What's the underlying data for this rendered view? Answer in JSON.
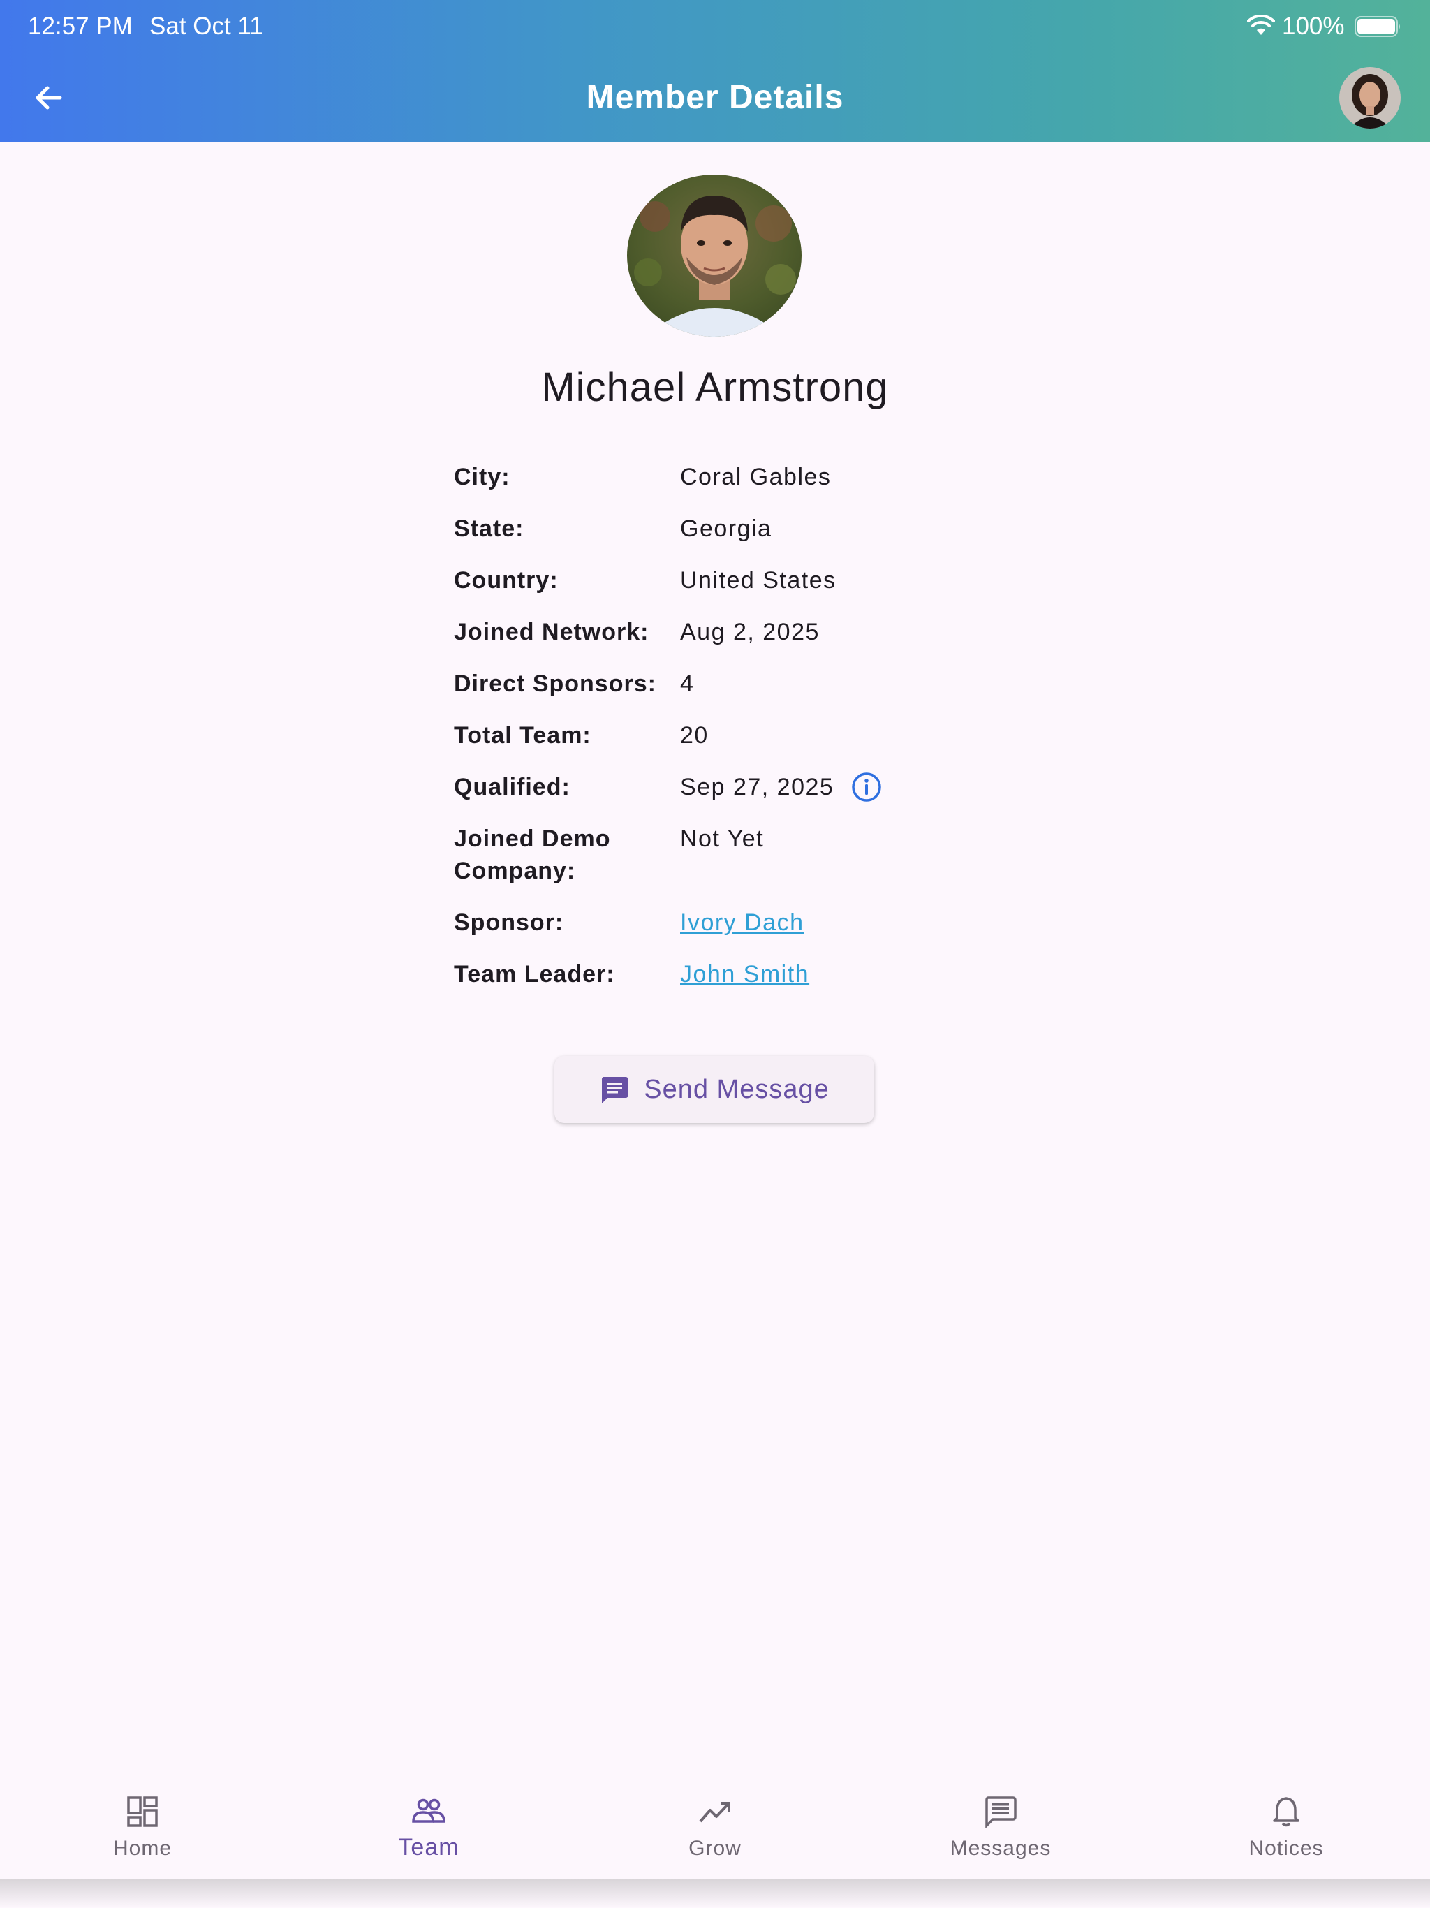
{
  "status_bar": {
    "time": "12:57 PM",
    "date": "Sat Oct 11",
    "battery": "100%"
  },
  "header": {
    "title": "Member Details"
  },
  "member": {
    "name": "Michael Armstrong",
    "details": [
      {
        "label": "City:",
        "value": "Coral Gables"
      },
      {
        "label": "State:",
        "value": "Georgia"
      },
      {
        "label": "Country:",
        "value": "United States"
      },
      {
        "label": "Joined Network:",
        "value": "Aug 2, 2025"
      },
      {
        "label": "Direct Sponsors:",
        "value": "4"
      },
      {
        "label": "Total Team:",
        "value": "20"
      },
      {
        "label": "Qualified:",
        "value": "Sep 27, 2025"
      },
      {
        "label": "Joined Demo Company:",
        "value": "Not Yet"
      },
      {
        "label": "Sponsor:",
        "value": "Ivory Dach"
      },
      {
        "label": "Team Leader:",
        "value": "John Smith"
      }
    ]
  },
  "actions": {
    "send_message": "Send Message"
  },
  "nav": {
    "items": [
      {
        "label": "Home",
        "icon": "dashboard-icon"
      },
      {
        "label": "Team",
        "icon": "team-icon",
        "active": true
      },
      {
        "label": "Grow",
        "icon": "trending-up-icon"
      },
      {
        "label": "Messages",
        "icon": "messages-icon"
      },
      {
        "label": "Notices",
        "icon": "bell-icon"
      }
    ]
  },
  "colors": {
    "accent": "#6750a4",
    "link": "#2f9fd5",
    "info_icon": "#2f6fe0",
    "background": "#fdf7fd"
  }
}
